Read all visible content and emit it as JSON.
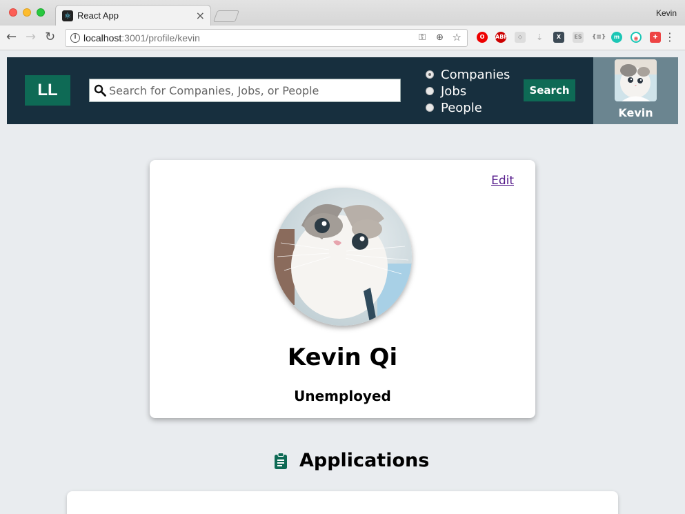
{
  "browser": {
    "tab_title": "React App",
    "profile_name": "Kevin",
    "url_host": "localhost",
    "url_path": ":3001/profile/kevin"
  },
  "header": {
    "logo": "LL",
    "search_placeholder": "Search for Companies, Jobs, or People",
    "radio_options": [
      "Companies",
      "Jobs",
      "People"
    ],
    "selected_option": "Companies",
    "search_button": "Search",
    "user_name": "Kevin"
  },
  "profile": {
    "edit_label": "Edit",
    "name": "Kevin Qi",
    "status": "Unemployed"
  },
  "applications": {
    "title": "Applications"
  },
  "colors": {
    "header_bg": "#172f3e",
    "accent": "#0e6a55",
    "user_panel_bg": "#6b8590",
    "page_bg": "#e9ecef"
  },
  "icons": {
    "search": "magnifier-icon",
    "applications": "clipboard-icon"
  }
}
